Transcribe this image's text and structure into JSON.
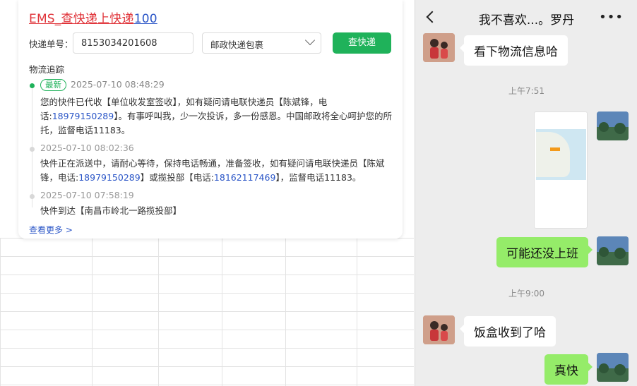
{
  "tracking": {
    "title_prefix": "EMS_",
    "title_main": "查快递上快递",
    "title_suffix": "100",
    "label_number": "快递单号：",
    "tracking_number": "8153034201608",
    "carrier": "邮政快递包裹",
    "query_button": "查快递",
    "section_title": "物流追踪",
    "latest_badge": "最新",
    "events": [
      {
        "time": "2025-07-10 08:48:29",
        "text_a": "您的快件已代收【单位收发室签收】，如有疑问请电联快递员【陈斌锋，电话:",
        "phone_a": "18979150289",
        "text_b": "】。有事呼叫我，少一次投诉，多一份感恩。中国邮政将全心呵护您的所托，监督电话11183。"
      },
      {
        "time": "2025-07-10 08:02:36",
        "text_a": "快件正在派送中，请耐心等待，保持电话畅通，准备签收，如有疑问请电联快递员【陈斌锋，电话:",
        "phone_a": "18979150289",
        "text_b": "】或揽投部【电话:",
        "phone_b": "18162117469",
        "text_c": "】，监督电话11183。"
      },
      {
        "time": "2025-07-10 07:58:19",
        "text_a": "快件到达【南昌市岭北一路揽投部】"
      }
    ],
    "more_link": "查看更多 >"
  },
  "chat": {
    "title": "我不喜欢...。罗丹",
    "messages": [
      {
        "side": "left",
        "text": "看下物流信息哈"
      },
      {
        "time": "上午7:51"
      },
      {
        "side": "right",
        "type": "image"
      },
      {
        "side": "right",
        "text": "可能还没上班"
      },
      {
        "time": "上午9:00"
      },
      {
        "side": "left",
        "text": "饭盒收到了哈"
      },
      {
        "side": "right",
        "text": "真快"
      }
    ]
  },
  "colors": {
    "accent_green": "#1fb25a",
    "link_blue": "#2b56c7",
    "ems_red": "#e0343a",
    "bubble_green": "#95ec69",
    "chat_bg": "#ededed"
  }
}
